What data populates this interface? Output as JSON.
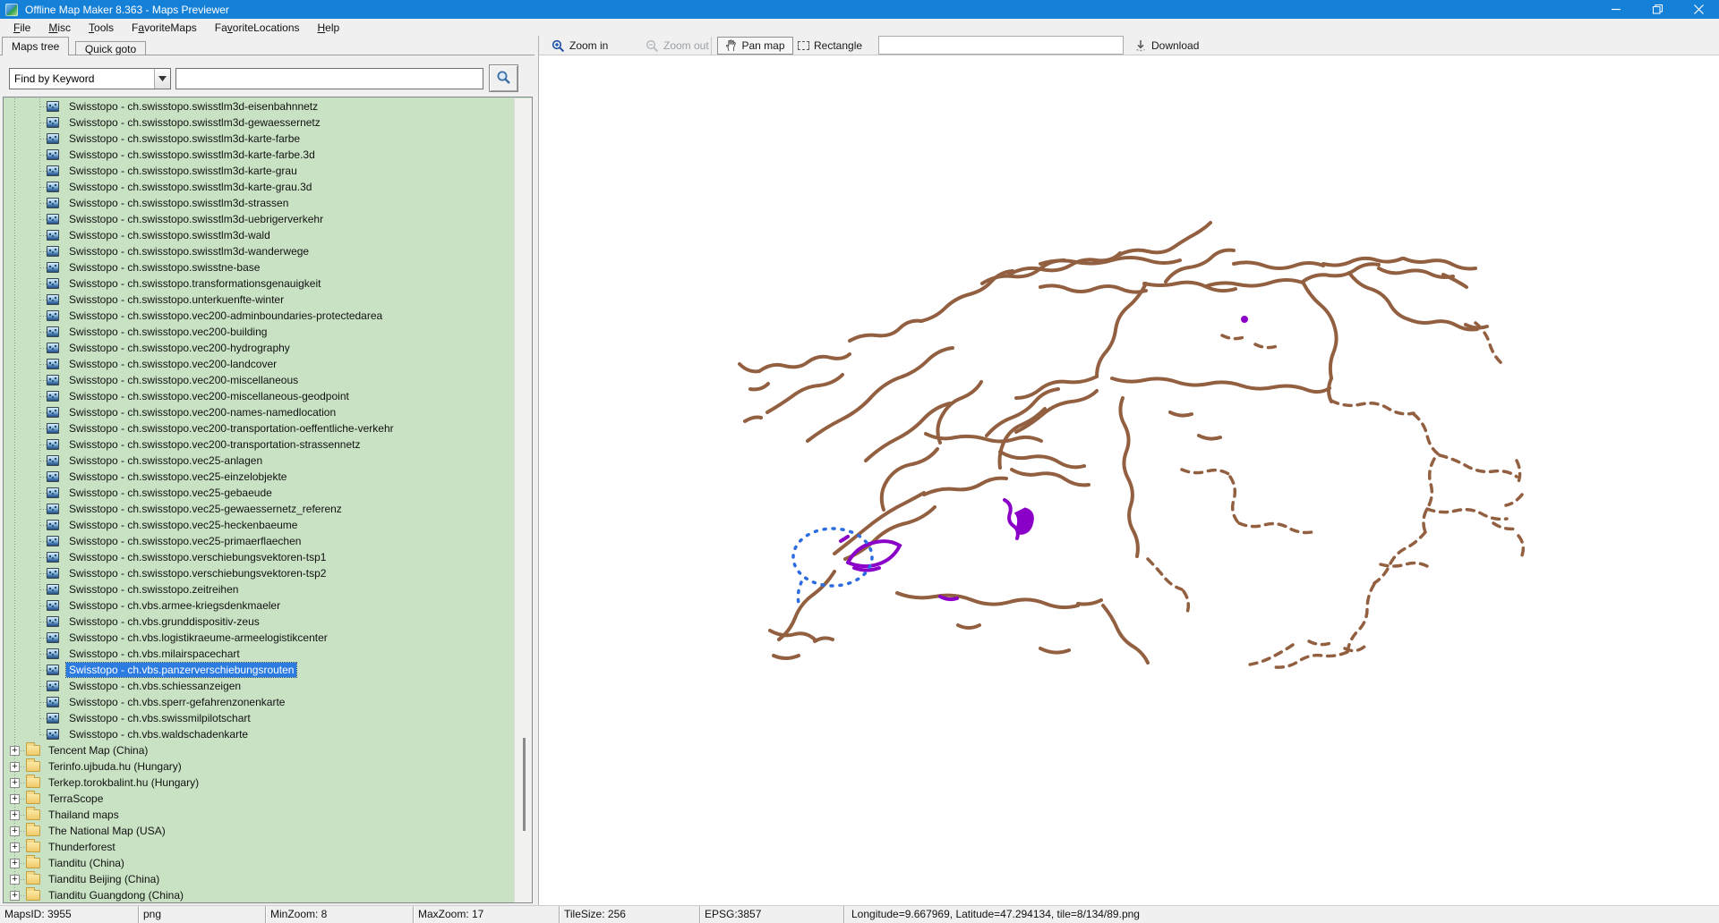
{
  "window": {
    "title": "Offline Map Maker 8.363 - Maps Previewer"
  },
  "menu": {
    "items": [
      {
        "pre": "",
        "u": "F",
        "post": "ile"
      },
      {
        "pre": "",
        "u": "M",
        "post": "isc"
      },
      {
        "pre": "",
        "u": "T",
        "post": "ools"
      },
      {
        "pre": "F",
        "u": "a",
        "post": "voriteMaps"
      },
      {
        "pre": "Fa",
        "u": "v",
        "post": "oriteLocations"
      },
      {
        "pre": "",
        "u": "H",
        "post": "elp"
      }
    ]
  },
  "tabs": {
    "maps_tree": "Maps tree",
    "quick_goto": "Quick goto"
  },
  "search": {
    "mode": "Find by Keyword",
    "query": "",
    "button_icon": "magnifier-icon"
  },
  "toolbar": {
    "zoom_in": "Zoom in",
    "zoom_out": "Zoom out",
    "pan_map": "Pan map",
    "rectangle": "Rectangle",
    "download": "Download",
    "input_value": ""
  },
  "tree": {
    "map_items": [
      "Swisstopo - ch.swisstopo.swisstlm3d-eisenbahnnetz",
      "Swisstopo - ch.swisstopo.swisstlm3d-gewaessernetz",
      "Swisstopo - ch.swisstopo.swisstlm3d-karte-farbe",
      "Swisstopo - ch.swisstopo.swisstlm3d-karte-farbe.3d",
      "Swisstopo - ch.swisstopo.swisstlm3d-karte-grau",
      "Swisstopo - ch.swisstopo.swisstlm3d-karte-grau.3d",
      "Swisstopo - ch.swisstopo.swisstlm3d-strassen",
      "Swisstopo - ch.swisstopo.swisstlm3d-uebrigerverkehr",
      "Swisstopo - ch.swisstopo.swisstlm3d-wald",
      "Swisstopo - ch.swisstopo.swisstlm3d-wanderwege",
      "Swisstopo - ch.swisstopo.swisstne-base",
      "Swisstopo - ch.swisstopo.transformationsgenauigkeit",
      "Swisstopo - ch.swisstopo.unterkuenfte-winter",
      "Swisstopo - ch.swisstopo.vec200-adminboundaries-protectedarea",
      "Swisstopo - ch.swisstopo.vec200-building",
      "Swisstopo - ch.swisstopo.vec200-hydrography",
      "Swisstopo - ch.swisstopo.vec200-landcover",
      "Swisstopo - ch.swisstopo.vec200-miscellaneous",
      "Swisstopo - ch.swisstopo.vec200-miscellaneous-geodpoint",
      "Swisstopo - ch.swisstopo.vec200-names-namedlocation",
      "Swisstopo - ch.swisstopo.vec200-transportation-oeffentliche-verkehr",
      "Swisstopo - ch.swisstopo.vec200-transportation-strassennetz",
      "Swisstopo - ch.swisstopo.vec25-anlagen",
      "Swisstopo - ch.swisstopo.vec25-einzelobjekte",
      "Swisstopo - ch.swisstopo.vec25-gebaeude",
      "Swisstopo - ch.swisstopo.vec25-gewaessernetz_referenz",
      "Swisstopo - ch.swisstopo.vec25-heckenbaeume",
      "Swisstopo - ch.swisstopo.vec25-primaerflaechen",
      "Swisstopo - ch.swisstopo.verschiebungsvektoren-tsp1",
      "Swisstopo - ch.swisstopo.verschiebungsvektoren-tsp2",
      "Swisstopo - ch.swisstopo.zeitreihen",
      "Swisstopo - ch.vbs.armee-kriegsdenkmaeler",
      "Swisstopo - ch.vbs.grunddispositiv-zeus",
      "Swisstopo - ch.vbs.logistikraeume-armeelogistikcenter",
      "Swisstopo - ch.vbs.milairspacechart",
      "Swisstopo - ch.vbs.panzerverschiebungsrouten",
      "Swisstopo - ch.vbs.schiessanzeigen",
      "Swisstopo - ch.vbs.sperr-gefahrenzonenkarte",
      "Swisstopo - ch.vbs.swissmilpilotschart",
      "Swisstopo - ch.vbs.waldschadenkarte"
    ],
    "selected_index": 35,
    "selected_item": "Swisstopo - ch.vbs.panzerverschiebungsrouten",
    "folders": [
      "Tencent Map (China)",
      "Terinfo.ujbuda.hu (Hungary)",
      "Terkep.torokbalint.hu (Hungary)",
      "TerraScope",
      "Thailand maps",
      "The National Map (USA)",
      "Thunderforest",
      "Tianditu (China)",
      "Tianditu Beijing (China)",
      "Tianditu Guangdong (China)"
    ]
  },
  "status": {
    "maps_id": "MapsID: 3955",
    "format": "png",
    "min_zoom": "MinZoom: 8",
    "max_zoom": "MaxZoom: 17",
    "tile_size": "TileSize: 256",
    "epsg": "EPSG:3857",
    "coords": "Longitude=9.667969, Latitude=47.294134, tile=8/134/89.png"
  },
  "map": {
    "colors": {
      "route": "#926040",
      "highlight": "#8a00c8",
      "selection": "#2b6ce0",
      "titlebar": "#1580d8",
      "tree_bg": "#c9e2c4",
      "selected_row": "#2c7be0"
    }
  }
}
